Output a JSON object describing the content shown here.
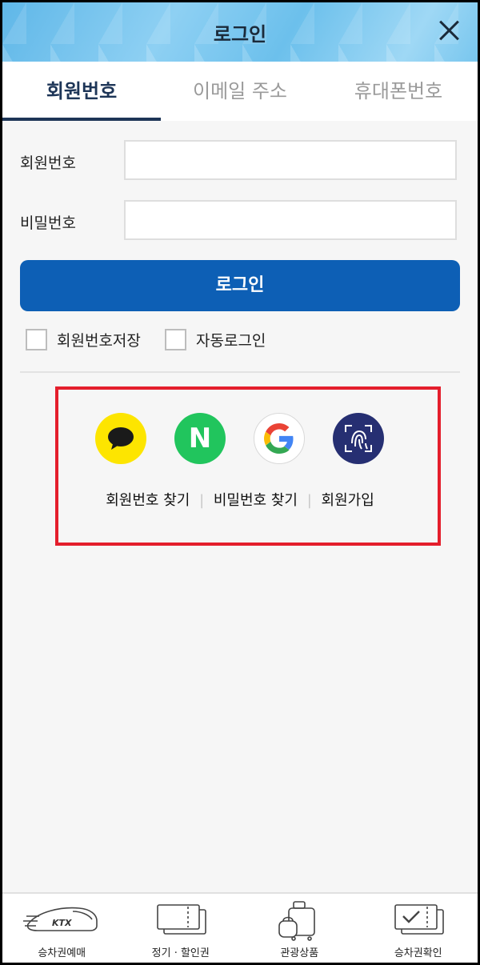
{
  "header": {
    "title": "로그인",
    "close_icon": "close-icon"
  },
  "tabs": [
    {
      "label": "회원번호",
      "active": true
    },
    {
      "label": "이메일 주소",
      "active": false
    },
    {
      "label": "휴대폰번호",
      "active": false
    }
  ],
  "form": {
    "member_number_label": "회원번호",
    "member_number_value": "",
    "password_label": "비밀번호",
    "password_value": "",
    "login_button": "로그인",
    "save_number_label": "회원번호저장",
    "auto_login_label": "자동로그인"
  },
  "social": {
    "kakao": "kakao-icon",
    "naver_glyph": "N",
    "google": "google-icon",
    "biometric": "fingerprint-icon"
  },
  "links": {
    "find_number": "회원번호 찾기",
    "find_password": "비밀번호 찾기",
    "signup": "회원가입",
    "separator": "|"
  },
  "bottom_nav": [
    {
      "label": "승차권예매",
      "icon": "train-icon",
      "badge": "KTX"
    },
    {
      "label": "정기 · 할인권",
      "icon": "ticket-icon"
    },
    {
      "label": "관광상품",
      "icon": "luggage-icon"
    },
    {
      "label": "승차권확인",
      "icon": "ticket-check-icon"
    }
  ],
  "colors": {
    "primary": "#0d5fb5",
    "tab_active": "#1d3557",
    "highlight_box": "#e41e2c",
    "kakao": "#fde500",
    "naver": "#21c55d",
    "biometric": "#262f72"
  }
}
